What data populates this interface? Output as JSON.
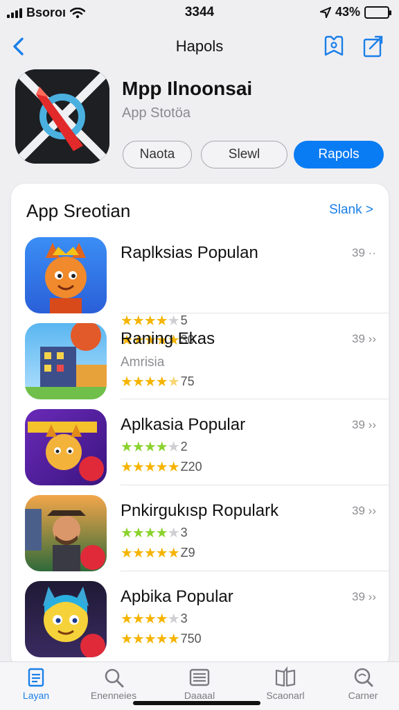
{
  "status_bar": {
    "carrier": "Bsoroı",
    "time": "3344",
    "battery_percent": "43%"
  },
  "nav": {
    "title": "Hapols"
  },
  "app": {
    "title": "Mpp Ilnoonsai",
    "subtitle": "App Stotöa",
    "buttons": [
      "Naota",
      "Slewl",
      "Rapols"
    ]
  },
  "section": {
    "title": "App Sreotian",
    "see_all": "Slank >",
    "items": [
      {
        "name": "Raplksias Populan",
        "meta": "39 ··",
        "subtitle": "",
        "rating_a": "5",
        "rating_b": "30"
      },
      {
        "name": "Raning Ekas",
        "meta": "39 ››",
        "subtitle": "Amrisia",
        "rating_a": "",
        "rating_b": "75"
      },
      {
        "name": "Aplkasia Popular",
        "meta": "39 ››",
        "subtitle": "",
        "rating_a": "2",
        "rating_b": "Z20"
      },
      {
        "name": "Pnkirgukısp Ropulark",
        "meta": "39 ››",
        "subtitle": "",
        "rating_a": "3",
        "rating_b": "Z9"
      },
      {
        "name": "Apbika Popular",
        "meta": "39 ››",
        "subtitle": "",
        "rating_a": "3",
        "rating_b": "750"
      }
    ]
  },
  "tabs": [
    "Layan",
    "Enenneies",
    "Daaaal",
    "Scaonarl",
    "Carner"
  ],
  "colors": {
    "accent": "#0a7cf3",
    "star": "#f5b400",
    "star_green": "#8bd22e"
  }
}
